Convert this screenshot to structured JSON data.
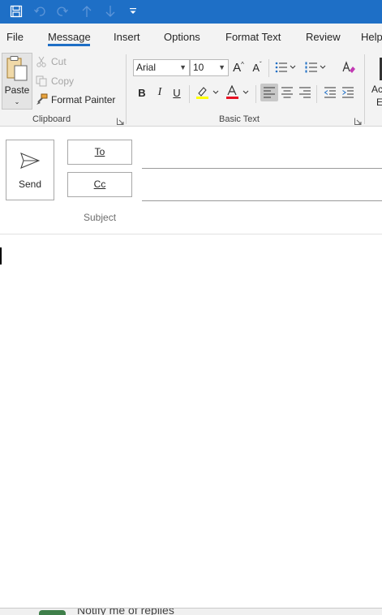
{
  "quick_access": {
    "icons": [
      "save-icon",
      "undo-icon",
      "redo-icon",
      "up-arrow-icon",
      "down-arrow-icon",
      "customize-qat-icon"
    ]
  },
  "tabs": [
    {
      "label": "File"
    },
    {
      "label": "Message",
      "active": true
    },
    {
      "label": "Insert"
    },
    {
      "label": "Options"
    },
    {
      "label": "Format Text"
    },
    {
      "label": "Review"
    },
    {
      "label": "Help"
    }
  ],
  "clipboard": {
    "paste": "Paste",
    "cut": "Cut",
    "copy": "Copy",
    "format_painter": "Format Painter",
    "group_label": "Clipboard"
  },
  "basic_text": {
    "font_name": "Arial",
    "font_size": "10",
    "bold": "B",
    "italic": "I",
    "underline": "U",
    "grow": "A",
    "shrink": "A",
    "group_label": "Basic Text"
  },
  "ribbon_cut_off": {
    "line1": "Ac",
    "line2": "E"
  },
  "compose": {
    "send_label": "Send",
    "to_label": "To",
    "cc_label": "Cc",
    "subject_label": "Subject"
  },
  "bottom": {
    "partial_text": "Notify me of replies"
  },
  "colors": {
    "accent": "#1e6fc6",
    "highlight": "#ffff00",
    "font_color": "#e81123"
  }
}
